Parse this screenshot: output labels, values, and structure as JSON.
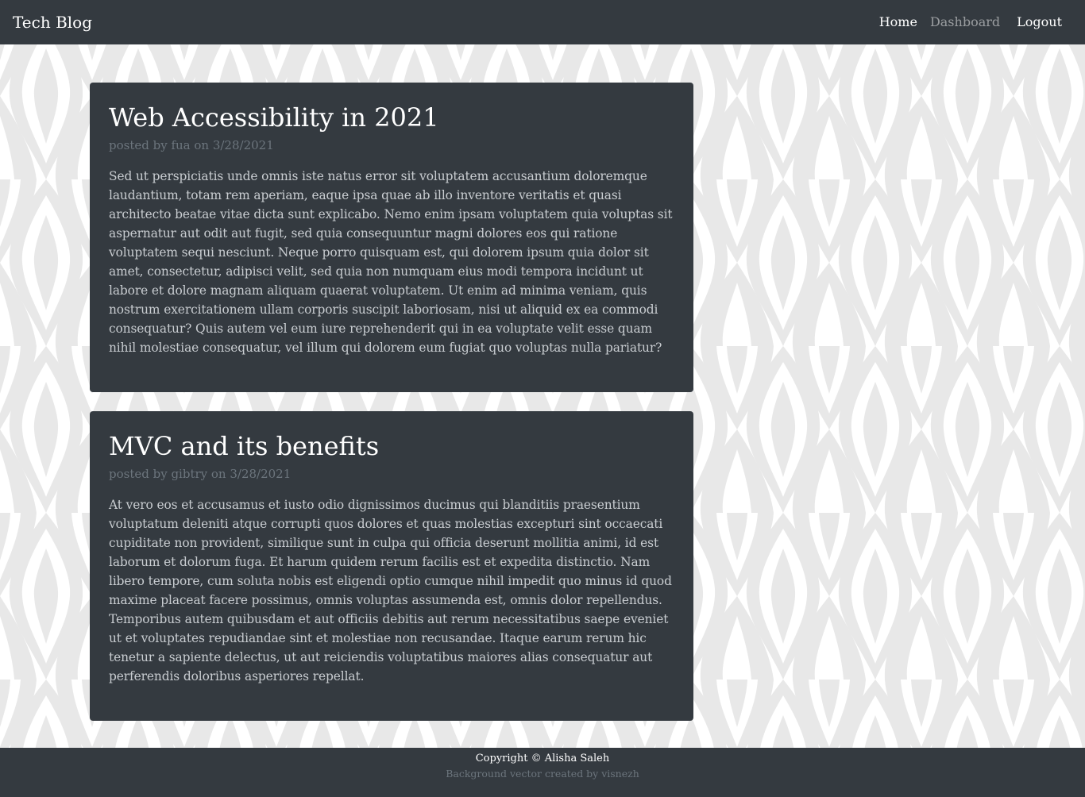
{
  "app": {
    "brand": "Tech Blog"
  },
  "nav": {
    "home": "Home",
    "dashboard": "Dashboard",
    "logout": "Logout"
  },
  "posts": [
    {
      "title": "Web Accessibility in 2021",
      "meta": "posted by fua on 3/28/2021",
      "body": "Sed ut perspiciatis unde omnis iste natus error sit voluptatem accusantium doloremque laudantium, totam rem aperiam, eaque ipsa quae ab illo inventore veritatis et quasi architecto beatae vitae dicta sunt explicabo. Nemo enim ipsam voluptatem quia voluptas sit aspernatur aut odit aut fugit, sed quia consequuntur magni dolores eos qui ratione voluptatem sequi nesciunt. Neque porro quisquam est, qui dolorem ipsum quia dolor sit amet, consectetur, adipisci velit, sed quia non numquam eius modi tempora incidunt ut labore et dolore magnam aliquam quaerat voluptatem. Ut enim ad minima veniam, quis nostrum exercitationem ullam corporis suscipit laboriosam, nisi ut aliquid ex ea commodi consequatur? Quis autem vel eum iure reprehenderit qui in ea voluptate velit esse quam nihil molestiae consequatur, vel illum qui dolorem eum fugiat quo voluptas nulla pariatur?"
    },
    {
      "title": "MVC and its benefits",
      "meta": "posted by gibtry on 3/28/2021",
      "body": "At vero eos et accusamus et iusto odio dignissimos ducimus qui blanditiis praesentium voluptatum deleniti atque corrupti quos dolores et quas molestias excepturi sint occaecati cupiditate non provident, similique sunt in culpa qui officia deserunt mollitia animi, id est laborum et dolorum fuga. Et harum quidem rerum facilis est et expedita distinctio. Nam libero tempore, cum soluta nobis est eligendi optio cumque nihil impedit quo minus id quod maxime placeat facere possimus, omnis voluptas assumenda est, omnis dolor repellendus. Temporibus autem quibusdam et aut officiis debitis aut rerum necessitatibus saepe eveniet ut et voluptates repudiandae sint et molestiae non recusandae. Itaque earum rerum hic tenetur a sapiente delectus, ut aut reiciendis voluptatibus maiores alias consequatur aut perferendis doloribus asperiores repellat."
    }
  ],
  "footer": {
    "copyright": "Copyright © Alisha Saleh",
    "credit": "Background vector created by visnezh"
  },
  "colors": {
    "navbar": "#343a40",
    "card": "#343a40",
    "muted": "#6c757d",
    "pattern": "#e8e8e8"
  }
}
